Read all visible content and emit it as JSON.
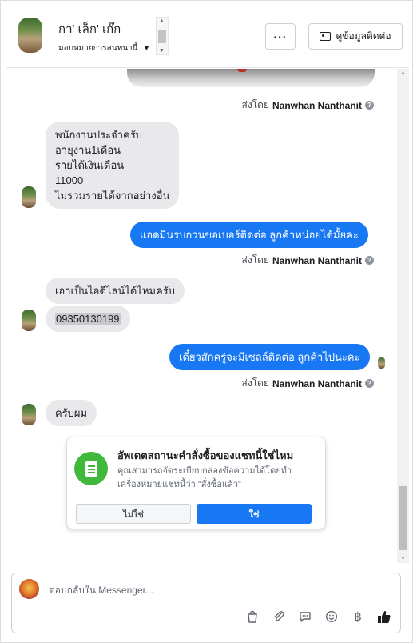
{
  "header": {
    "contact_name": "กา' เล็ก' เก๊ก",
    "assign_label": "มอบหมายการสนทนานี้",
    "more_label": "···",
    "contact_info_label": "ดูข้อมูลติดต่อ"
  },
  "thread": {
    "sent_by_prefix": "ส่งโดย",
    "sender_name": "Nanwhan Nanthanit",
    "messages": [
      {
        "direction": "in",
        "lines": [
          "พนักงานประจำครับ",
          "อายุงาน1เดือน",
          "รายได้เงินเดือน",
          "11000",
          "ไม่รวมรายได้จากอย่างอื่น"
        ]
      },
      {
        "direction": "out",
        "text": "แอดมินรบกวนขอเบอร์ติดต่อ ลูกค้าหน่อยได้มั้ยคะ"
      },
      {
        "direction": "in",
        "text": "เอาเป็นไอดีไลน์ได้ไหมครับ"
      },
      {
        "direction": "in",
        "text": "09350130199"
      },
      {
        "direction": "out",
        "text": "เดี๋ยวสักครู่จะมีเซลล์ติดต่อ ลูกค้าไปนะคะ"
      },
      {
        "direction": "in",
        "text": "ครับผม"
      }
    ]
  },
  "order_prompt": {
    "title": "อัพเดตสถานะคำสั่งซื้อของแชทนี้ใช่ไหม",
    "description": "คุณสามารถจัดระเบียบกล่องข้อความได้โดยทำเครื่องหมายแชทนี้ว่า \"สั่งซื้อแล้ว\"",
    "no_label": "ไม่ใช่",
    "yes_label": "ใช่"
  },
  "composer": {
    "placeholder": "ตอบกลับใน Messenger..."
  },
  "colors": {
    "accent": "#1877f2",
    "incoming_bubble": "#e9e9eb",
    "order_icon": "#3fb83c"
  },
  "icons": [
    "shopping-bag-icon",
    "paperclip-icon",
    "chat-icon",
    "emoji-icon",
    "baht-icon",
    "thumbs-up-icon"
  ]
}
